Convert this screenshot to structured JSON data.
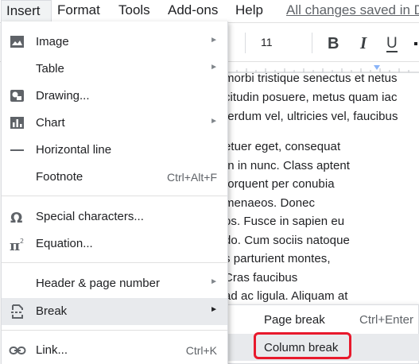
{
  "menubar": {
    "insert": "Insert",
    "format": "Format",
    "tools": "Tools",
    "addons": "Add-ons",
    "help": "Help",
    "save_status": "All changes saved in Drive"
  },
  "toolbar": {
    "font_size": "11",
    "bold_label": "B",
    "italic_label": "I",
    "underline_label": "U"
  },
  "document": {
    "lines": [
      "morbi tristique senectus et netus",
      "citudin posuere, metus quam iac",
      "terdum vel, ultricies vel, faucibus",
      "etuer eget, consequat",
      "In in nunc. Class aptent",
      "torquent per conubia",
      "menaeos. Donec",
      "os. Fusce in sapien eu",
      "do. Cum sociis natoque",
      "s parturient montes,",
      "Cras faucibus",
      "ad ac ligula. Aliquam at"
    ]
  },
  "insert_menu": {
    "items": [
      {
        "label": "Image",
        "icon": "image-icon",
        "submenu": true
      },
      {
        "label": "Table",
        "icon": "",
        "submenu": true
      },
      {
        "label": "Drawing...",
        "icon": "drawing-icon",
        "submenu": false
      },
      {
        "label": "Chart",
        "icon": "chart-icon",
        "submenu": true
      },
      {
        "label": "Horizontal line",
        "icon": "horizontal-line-icon",
        "submenu": false
      },
      {
        "label": "Footnote",
        "icon": "",
        "shortcut": "Ctrl+Alt+F"
      },
      {
        "label": "Special characters...",
        "icon": "omega-icon",
        "submenu": false
      },
      {
        "label": "Equation...",
        "icon": "pi-icon",
        "submenu": false
      },
      {
        "label": "Header & page number",
        "icon": "",
        "submenu": true
      },
      {
        "label": "Break",
        "icon": "break-icon",
        "submenu": true,
        "active": true
      },
      {
        "label": "Link...",
        "icon": "link-icon",
        "shortcut": "Ctrl+K"
      }
    ]
  },
  "break_submenu": {
    "items": [
      {
        "label": "Page break",
        "shortcut": "Ctrl+Enter"
      },
      {
        "label": "Column break",
        "shortcut": "",
        "highlighted": true
      }
    ]
  },
  "colors": {
    "highlight_outline": "#e8192c",
    "hover_background": "#e8eaed",
    "icon_gray": "#5f6368"
  }
}
